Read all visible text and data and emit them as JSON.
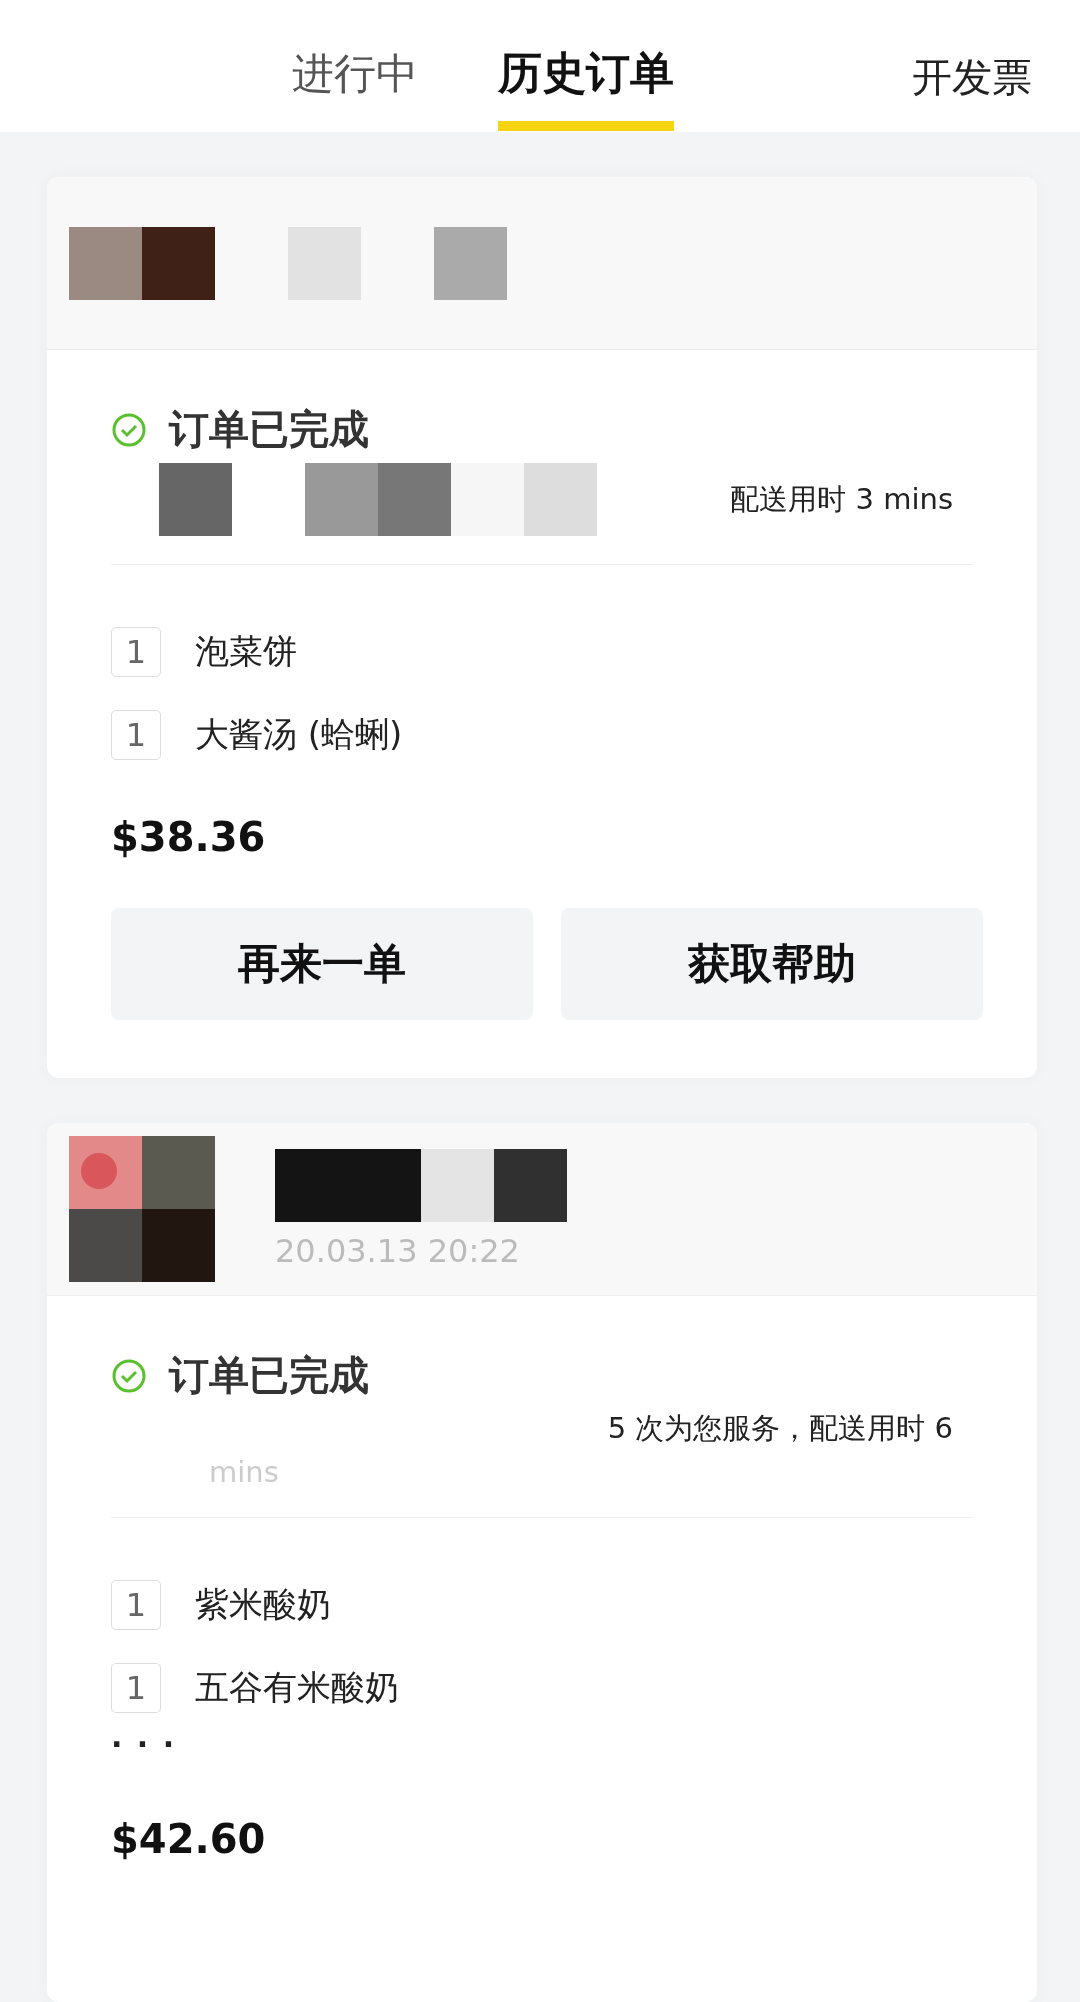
{
  "tabs": [
    {
      "label": "进行中",
      "selected": false
    },
    {
      "label": "历史订单",
      "selected": true
    }
  ],
  "invoice_link": "开发票",
  "orders": [
    {
      "header": {
        "kind": "mosaic"
      },
      "status": {
        "label": "订单已完成",
        "completed": true
      },
      "description": "配送用时 3 mins",
      "items": [
        {
          "qty": "1",
          "name": "泡菜饼"
        },
        {
          "qty": "1",
          "name": "大酱汤 (蛤蜊)"
        }
      ],
      "price": "$38.36",
      "buttons": [
        "再来一单",
        "获取帮助"
      ]
    },
    {
      "header": {
        "kind": "thumbnail",
        "date": "20.03.13 20:22"
      },
      "status": {
        "label": "订单已完成",
        "completed": true
      },
      "description": "5 次为您服务，配送用时 6",
      "description_faded": "mins",
      "items": [
        {
          "qty": "1",
          "name": "紫米酸奶"
        },
        {
          "qty": "1",
          "name": "五谷有米酸奶"
        }
      ],
      "more": "· · ·",
      "price": "$42.60"
    }
  ]
}
